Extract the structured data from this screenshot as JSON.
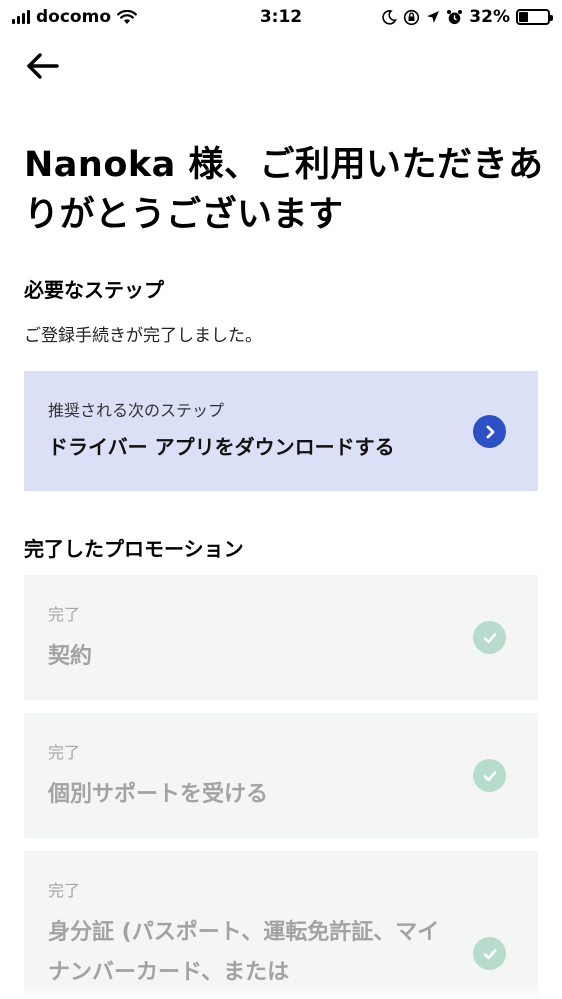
{
  "status_bar": {
    "carrier": "docomo",
    "time": "3:12",
    "battery": "32%",
    "battery_level": 0.32
  },
  "header": {
    "title": "Nanoka 様、ご利用いただきありがとうございます"
  },
  "required_steps": {
    "heading": "必要なステップ",
    "message": "ご登録手続きが完了しました。"
  },
  "next_step": {
    "caption": "推奨される次のステップ",
    "action": "ドライバー アプリをダウンロードする"
  },
  "promotions": {
    "heading": "完了したプロモーション",
    "items": [
      {
        "status": "完了",
        "label": "契約"
      },
      {
        "status": "完了",
        "label": "個別サポートを受ける"
      },
      {
        "status": "完了",
        "label": "身分証 (パスポート、運転免許証、マイナンバーカード、または"
      }
    ]
  }
}
